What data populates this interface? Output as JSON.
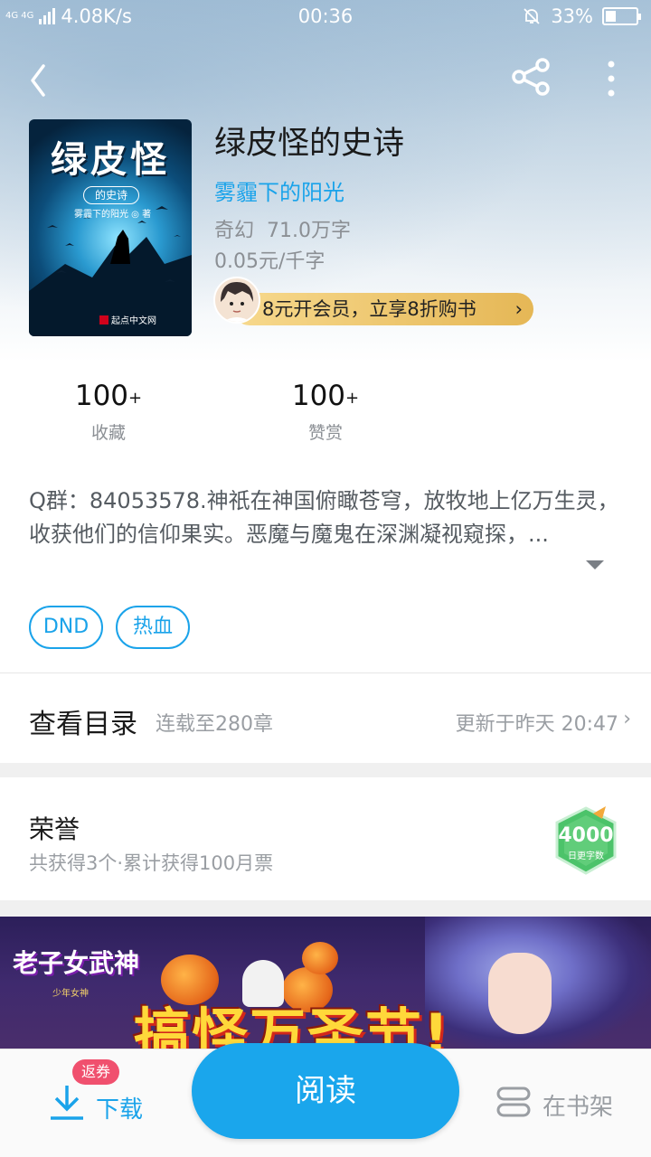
{
  "status": {
    "network": "4G 4G",
    "speed": "4.08K/s",
    "time": "00:36",
    "battery": "33%"
  },
  "book": {
    "title": "绿皮怪的史诗",
    "author": "雾霾下的阳光",
    "genre": "奇幻",
    "words": "71.0万字",
    "price": "0.05元/千字",
    "cover": {
      "title": "绿皮怪",
      "subtitle": "的史诗",
      "author_line": "雾霾下的阳光 ◎ 著",
      "publisher": "起点中文网"
    }
  },
  "vip_banner": {
    "text": "8元开会员，立享8折购书",
    "chevron": "›"
  },
  "stats": [
    {
      "value": "100",
      "suffix": "+",
      "label": "收藏"
    },
    {
      "value": "100",
      "suffix": "+",
      "label": "赞赏"
    }
  ],
  "description": "Q群：84053578.神祇在神国俯瞰苍穹，放牧地上亿万生灵，收获他们的信仰果实。恶魔与魔鬼在深渊凝视窥探，...",
  "tags": [
    "DND",
    "热血"
  ],
  "toc": {
    "title": "查看目录",
    "serial": "连载至280章",
    "updated": "更新于昨天 20:47",
    "chevron": "›"
  },
  "honor": {
    "title": "荣誉",
    "subtitle": "共获得3个·累计获得100月票",
    "badge_value": "4000",
    "badge_label": "日更字数"
  },
  "ad": {
    "logo": "老子女武神",
    "logo_sub": "少年女神",
    "title": "搞怪万圣节!"
  },
  "bottom": {
    "coupon": "返券",
    "download": "下载",
    "read": "阅读",
    "shelf": "在书架"
  },
  "colors": {
    "accent": "#1aa3ea",
    "vip_gold": "#e5b756",
    "coupon_red": "#f0506e",
    "badge_green": "#4cc36a"
  },
  "icons": [
    "back-icon",
    "share-icon",
    "more-icon",
    "download-icon",
    "bookshelf-icon",
    "expand-icon",
    "chevron-right-icon"
  ]
}
